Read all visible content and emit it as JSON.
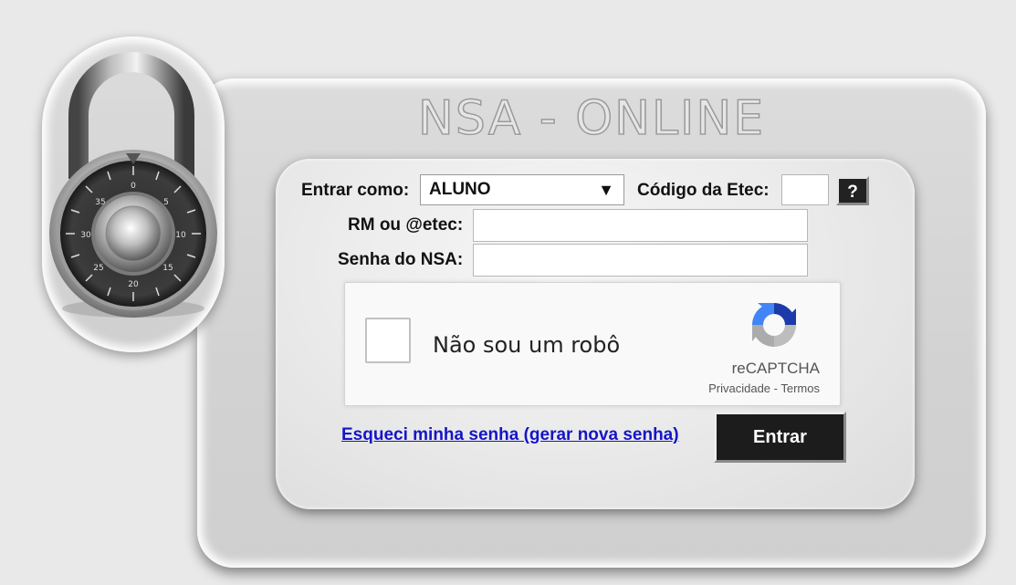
{
  "header": {
    "title": "NSA - ONLINE"
  },
  "login_form": {
    "role_label": "Entrar como:",
    "role_selected": "ALUNO",
    "role_arrow": "▼",
    "etec_code_label": "Código da Etec:",
    "etec_code_value": "",
    "help_label": "?",
    "rm_label": "RM ou @etec:",
    "rm_value": "",
    "password_label": "Senha do NSA:",
    "password_value": "",
    "forgot_link": "Esqueci minha senha (gerar nova senha)",
    "submit_label": "Entrar"
  },
  "recaptcha": {
    "checkbox_label": "Não sou um robô",
    "brand": "reCAPTCHA",
    "privacy_link": "Privacidade",
    "separator": " - ",
    "terms_link": "Termos"
  },
  "icons": {
    "padlock": "combination-lock-icon",
    "captcha_logo": "recaptcha-logo-icon",
    "dropdown": "chevron-down-icon"
  },
  "colors": {
    "background": "#e9e9e9",
    "button": "#1c1c1c",
    "link": "#1515c8"
  }
}
